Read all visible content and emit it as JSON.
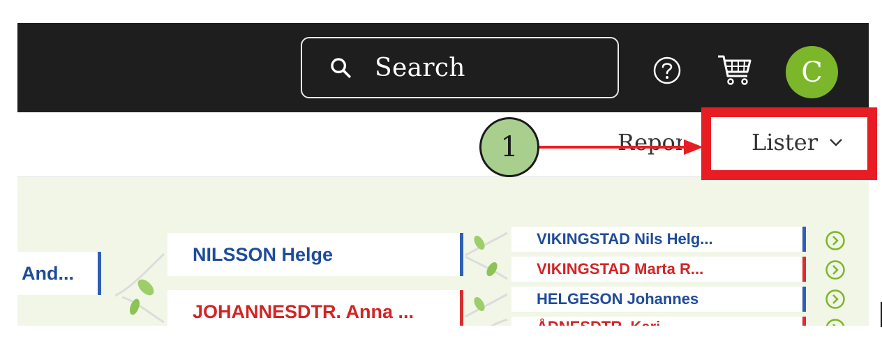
{
  "header": {
    "search": {
      "placeholder": "Search",
      "icon": "search-icon"
    },
    "help_icon": "help-circle-icon",
    "cart_icon": "shopping-cart-icon",
    "avatar_initial": "C",
    "avatar_color": "#7cb62b"
  },
  "subnav": {
    "items": [
      {
        "label": "Report"
      },
      {
        "label": "Lister",
        "icon": "chevron-down-icon"
      }
    ]
  },
  "tree": {
    "root_partial": "And...",
    "parents": [
      {
        "name": "NILSSON Helge",
        "gender": "male"
      },
      {
        "name": "JOHANNESDTR. Anna ...",
        "gender": "female"
      }
    ],
    "grandparents": [
      {
        "name": "VIKINGSTAD Nils Helg...",
        "gender": "male"
      },
      {
        "name": "VIKINGSTAD Marta R...",
        "gender": "female"
      },
      {
        "name": "HELGESON Johannes",
        "gender": "male"
      },
      {
        "name": "ÅDNESDTR. Kari",
        "gender": "female"
      }
    ]
  },
  "annotation": {
    "step_number": "1",
    "color_marker": "#a8cf8e",
    "color_highlight": "#e81d24"
  },
  "colors": {
    "header_bg": "#1e1e1e",
    "tree_bg": "#f1f6e6",
    "male": "#1f4c9a",
    "female": "#d32424",
    "go_button": "#7cb62b"
  }
}
